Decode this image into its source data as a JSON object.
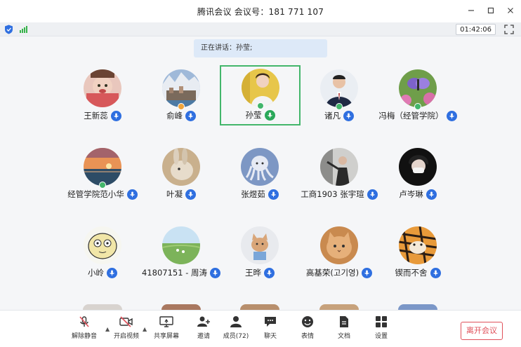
{
  "window": {
    "title": "腾讯会议 会议号：181 771 107",
    "controls": [
      "minimize-icon",
      "maximize-icon",
      "close-icon"
    ]
  },
  "status": {
    "timer": "01:42:06"
  },
  "speaking_banner": "正在讲话：孙莹;",
  "participants": [
    {
      "name": "王新蕊",
      "mic": "on",
      "avatar": "child-photo"
    },
    {
      "name": "俞峰",
      "mic": "on",
      "avatar": "town-photo"
    },
    {
      "name": "孙莹",
      "mic": "speaking",
      "avatar": "woman-photo"
    },
    {
      "name": "诸凡",
      "mic": "on",
      "avatar": "man-suit-photo"
    },
    {
      "name": "冯梅（经管学院）",
      "mic": "on",
      "avatar": "butterfly-photo"
    },
    {
      "name": "经管学院范小华",
      "mic": "on",
      "avatar": "sunset-photo"
    },
    {
      "name": "叶凝",
      "mic": "on",
      "avatar": "rabbit-photo"
    },
    {
      "name": "张煜茹",
      "mic": "on",
      "avatar": "octopus-cartoon"
    },
    {
      "name": "工商1903 张宇瑄",
      "mic": "on",
      "avatar": "dancer-photo"
    },
    {
      "name": "卢岑琳",
      "mic": "on",
      "avatar": "masked-photo"
    },
    {
      "name": "小岭",
      "mic": "on",
      "avatar": "cartoon-face"
    },
    {
      "name": "41807151 - 周涛",
      "mic": "on",
      "avatar": "field-photo"
    },
    {
      "name": "王晔",
      "mic": "on",
      "avatar": "cat-cartoon"
    },
    {
      "name": "高基荣(고기영)",
      "mic": "on",
      "avatar": "cat-photo"
    },
    {
      "name": "锲而不舍",
      "mic": "on",
      "avatar": "tiger-photo"
    }
  ],
  "toolbar": {
    "unmute": "解除静音",
    "start_video": "开启视频",
    "share_screen": "共享屏幕",
    "invite": "邀请",
    "members": "成员(72)",
    "chat": "聊天",
    "emoji": "表情",
    "docs": "文档",
    "settings": "设置",
    "leave": "离开会议"
  },
  "colors": {
    "accent_blue": "#2f6fe0",
    "active_border": "#43b66b",
    "leave_red": "#e0505a",
    "banner_bg": "#dde9f8"
  }
}
